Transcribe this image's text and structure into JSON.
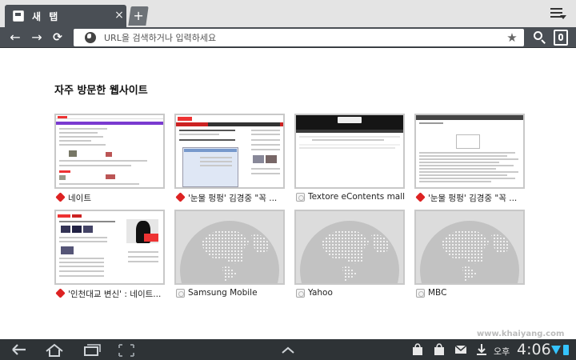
{
  "tabs": [
    {
      "title": "새 탭",
      "close_label": "×"
    }
  ],
  "new_tab_label": "+",
  "toolbar": {
    "back": "←",
    "forward": "→",
    "reload": "⟳",
    "url_placeholder": "URL을 검색하거나 입력하세요",
    "star": "★"
  },
  "section_title": "자주 방문한 웹사이트",
  "tiles": [
    {
      "title": "네이트",
      "favicon": "red",
      "thumb": "nate-portal"
    },
    {
      "title": "'눈물 펑펑' 김경중 \"꼭 ...",
      "favicon": "red",
      "thumb": "news-article"
    },
    {
      "title": "Textore eContents mall",
      "favicon": "gray",
      "thumb": "textore"
    },
    {
      "title": "'눈물 펑펑' 김경중 \"꼭 ...",
      "favicon": "red",
      "thumb": "text-page"
    },
    {
      "title": "'인천대교 변신' : 네이트...",
      "favicon": "red",
      "thumb": "nate-news"
    },
    {
      "title": "Samsung Mobile",
      "favicon": "gray",
      "thumb": "globe"
    },
    {
      "title": "Yahoo",
      "favicon": "gray",
      "thumb": "globe"
    },
    {
      "title": "MBC",
      "favicon": "gray",
      "thumb": "globe"
    }
  ],
  "system_bar": {
    "ampm": "오후",
    "time": "4:06"
  },
  "watermark": "www.khaiyang.com",
  "colors": {
    "toolbar": "#4a4f55",
    "system_bar": "#2e3336",
    "status_accent": "#35c4ff",
    "favicon_red": "#dd2222"
  }
}
